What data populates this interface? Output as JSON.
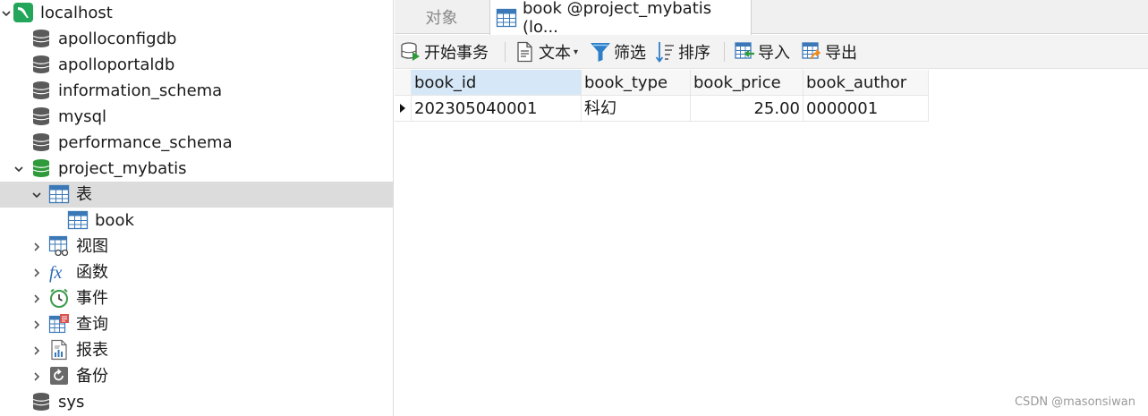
{
  "sidebar": {
    "connection": "localhost",
    "databases": [
      "apolloconfigdb",
      "apolloportaldb",
      "information_schema",
      "mysql",
      "performance_schema",
      "project_mybatis"
    ],
    "project_children": [
      "表",
      "book",
      "视图",
      "函数",
      "事件",
      "查询",
      "报表",
      "备份"
    ],
    "last_db": "sys"
  },
  "tabs": {
    "objects": "对象",
    "active": "book @project_mybatis (lo..."
  },
  "toolbar": {
    "begin_transaction": "开始事务",
    "text": "文本",
    "filter": "筛选",
    "sort": "排序",
    "import": "导入",
    "export": "导出"
  },
  "grid": {
    "columns": [
      "book_id",
      "book_type",
      "book_price",
      "book_author"
    ],
    "rows": [
      [
        "202305040001",
        "科幻",
        "25.00",
        "0000001"
      ]
    ]
  },
  "watermark": "CSDN @masonsiwan",
  "colors": {
    "db_icon": "#555555",
    "db_icon_active": "#2e9a3a",
    "connection_icon": "#23a55a",
    "table_icon": "#3a78b8",
    "selected_row": "#dcdcdc",
    "header_selected": "#d6e8f7"
  }
}
